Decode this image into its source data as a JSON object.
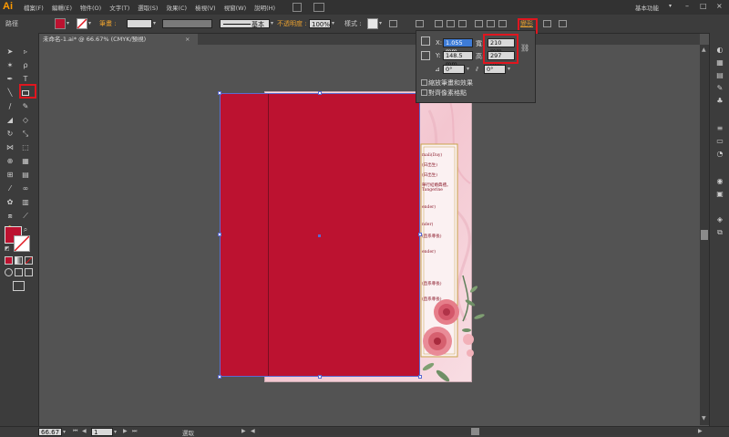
{
  "app": {
    "logo": "Ai"
  },
  "menubar": {
    "items": [
      "檔案(F)",
      "編輯(E)",
      "物件(O)",
      "文字(T)",
      "選取(S)",
      "效果(C)",
      "檢視(V)",
      "視窗(W)",
      "說明(H)"
    ],
    "workspace": "基本功能"
  },
  "controlbar": {
    "selection_label": "路徑",
    "stroke_label": "筆畫 :",
    "stroke_style": "基本",
    "opacity_label": "不透明度 :",
    "opacity_value": "100%",
    "style_label": "樣式 :",
    "transform_link": "變形",
    "colors": {
      "fill": "#bc1230",
      "accent": "#e8a030"
    }
  },
  "document": {
    "tab_title": "未命名-1.ai* @ 66.67% (CMYK/預視)"
  },
  "transform_panel": {
    "x_label": "X:",
    "x_value": "1.055 mm",
    "y_label": "Y:",
    "y_value": "148.5 mm",
    "w_label": "寬:",
    "w_value": "210 mm",
    "h_label": "高:",
    "h_value": "297 mm",
    "rotate_value": "0°",
    "shear_value": "0°",
    "option1": "縮放筆畫和效果",
    "option2": "對齊像素格點"
  },
  "statusbar": {
    "zoom": "66.67",
    "page": "1",
    "mode": "選取"
  },
  "invitation_lines": [
    "mali(Day)",
    "(日出生)",
    "(日出生)",
    "舉行結婚典禮。",
    "Tangerine",
    "ender)",
    "nder)",
    "(直系尊長)",
    "ender)",
    "(直系尊長)",
    "(直系尊長)"
  ]
}
